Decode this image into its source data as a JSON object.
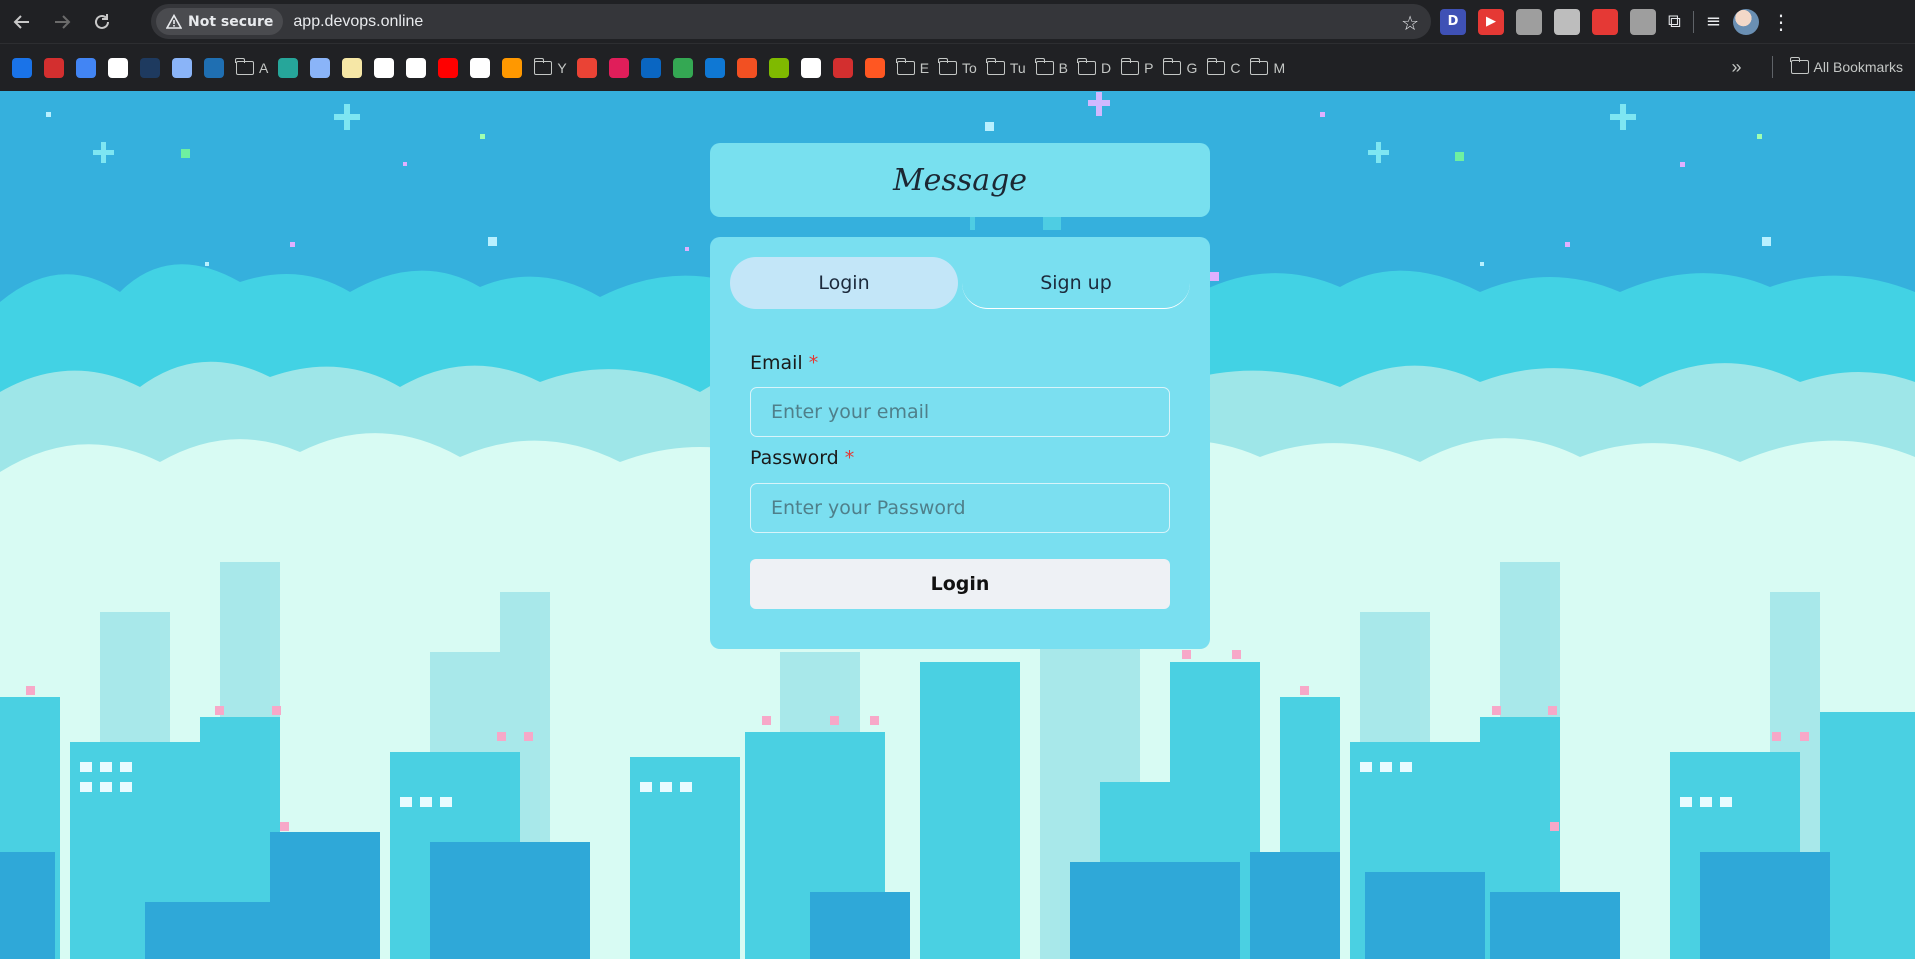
{
  "browser": {
    "security_label": "Not secure",
    "url": "app.devops.online",
    "bookmarks": [
      {
        "label": "",
        "icon": "zalo-icon",
        "color": "#1a73e8"
      },
      {
        "label": "",
        "icon": "stack-icon",
        "color": "#d32f2f"
      },
      {
        "label": "",
        "icon": "translate-icon",
        "color": "#4285f4"
      },
      {
        "label": "",
        "icon": "github-icon",
        "color": "#ffffff"
      },
      {
        "label": "",
        "icon": "dark-site-icon",
        "color": "#1e3a5f"
      },
      {
        "label": "",
        "icon": "hexagon-icon",
        "color": "#8ab4f8"
      },
      {
        "label": "",
        "icon": "azure-icon",
        "color": "#1f6fb2"
      },
      {
        "label": "A",
        "icon": "folder-icon"
      },
      {
        "label": "",
        "icon": "tool-icon",
        "color": "#26a69a"
      },
      {
        "label": "",
        "icon": "gemini-icon",
        "color": "#8ab4f8"
      },
      {
        "label": "",
        "icon": "notes-icon",
        "color": "#f6e7a6"
      },
      {
        "label": "",
        "icon": "chatgpt-icon",
        "color": "#ffffff"
      },
      {
        "label": "",
        "icon": "bot-icon",
        "color": "#ffffff"
      },
      {
        "label": "",
        "icon": "youtube-icon",
        "color": "#ff0000"
      },
      {
        "label": "",
        "icon": "google-icon",
        "color": "#ffffff"
      },
      {
        "label": "",
        "icon": "fire-icon",
        "color": "#ff9800"
      },
      {
        "label": "Y",
        "icon": "folder-icon"
      },
      {
        "label": "",
        "icon": "gmail-icon",
        "color": "#ea4335"
      },
      {
        "label": "",
        "icon": "slack-icon",
        "color": "#e01e5a"
      },
      {
        "label": "",
        "icon": "linkedin-icon",
        "color": "#0a66c2"
      },
      {
        "label": "",
        "icon": "drive-icon",
        "color": "#34a853"
      },
      {
        "label": "",
        "icon": "onedrive-icon",
        "color": "#0f78d4"
      },
      {
        "label": "",
        "icon": "microsoft-icon",
        "color": "#f25022"
      },
      {
        "label": "",
        "icon": "microsoft2-icon",
        "color": "#7fba00"
      },
      {
        "label": "",
        "icon": "chart-icon",
        "color": "#ffffff"
      },
      {
        "label": "",
        "icon": "report-icon",
        "color": "#d32f2f"
      },
      {
        "label": "",
        "icon": "target-icon",
        "color": "#ff5722"
      },
      {
        "label": "E",
        "icon": "folder-icon"
      },
      {
        "label": "To",
        "icon": "folder-icon"
      },
      {
        "label": "Tu",
        "icon": "folder-icon"
      },
      {
        "label": "B",
        "icon": "folder-icon"
      },
      {
        "label": "D",
        "icon": "folder-icon"
      },
      {
        "label": "P",
        "icon": "folder-icon"
      },
      {
        "label": "G",
        "icon": "folder-icon"
      },
      {
        "label": "C",
        "icon": "folder-icon"
      },
      {
        "label": "M",
        "icon": "folder-icon"
      }
    ],
    "overflow_label": "»",
    "all_bookmarks_label": "All Bookmarks",
    "extensions": [
      {
        "label": "D",
        "icon": "d-extension-icon",
        "color": "#3f51b5"
      },
      {
        "label": "▶",
        "icon": "video-extension-icon",
        "color": "#e53935"
      },
      {
        "label": "",
        "icon": "paused-extension-icon",
        "color": "#9e9e9e"
      },
      {
        "label": "",
        "icon": "tool-extension-icon",
        "color": "#bdbdbd"
      },
      {
        "label": "",
        "icon": "shield-extension-icon",
        "color": "#e53935"
      },
      {
        "label": "",
        "icon": "hand-extension-icon",
        "color": "#9e9e9e"
      }
    ]
  },
  "page": {
    "title": "Message",
    "tabs": {
      "login": "Login",
      "signup": "Sign up"
    },
    "email": {
      "label": "Email",
      "required_mark": "*",
      "placeholder": "Enter your email"
    },
    "password": {
      "label": "Password",
      "required_mark": "*",
      "placeholder": "Enter your Password"
    },
    "submit_label": "Login"
  },
  "colors": {
    "sky": "#35b0dd",
    "card": "#79dff0",
    "active_tab": "#c3e6f8",
    "button": "#eef1f5",
    "required": "#e53935"
  }
}
